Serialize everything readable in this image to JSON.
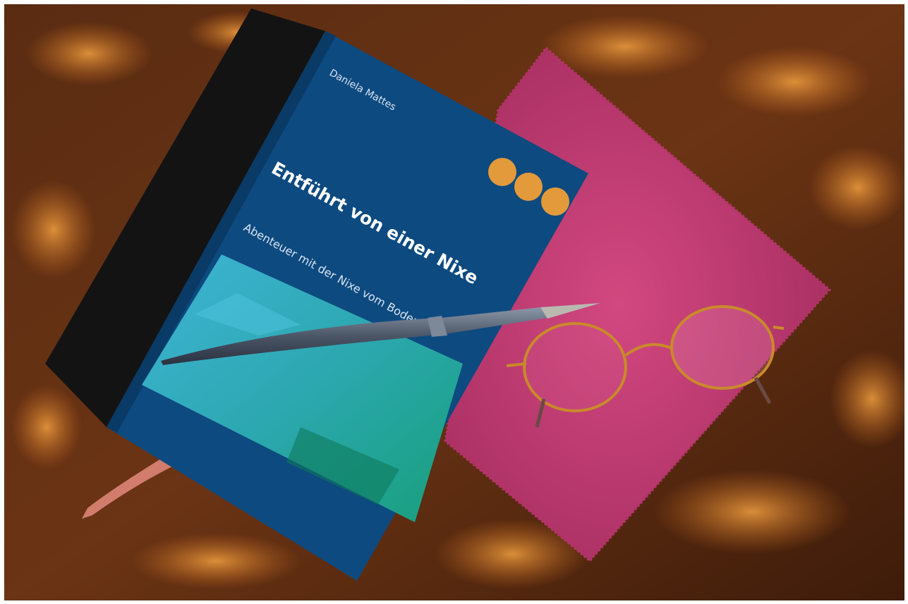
{
  "book": {
    "author": "Daniela Mattes",
    "title": "Entführt von einer Nixe",
    "subtitle": "Abenteuer mit der Nixe vom Bodensee",
    "badge_dot_color": "#e39a3a",
    "cover_color": "#0d4a80"
  },
  "colors": {
    "table": "#6b3414",
    "cloth": "#c03a70",
    "bookmark": "#d27c6e"
  },
  "objects": [
    "book-cover-icon",
    "fountain-pen-icon",
    "eyeglasses-icon",
    "cleaning-cloth-icon",
    "bookmark-ribbon-icon",
    "black-notebook-icon"
  ]
}
